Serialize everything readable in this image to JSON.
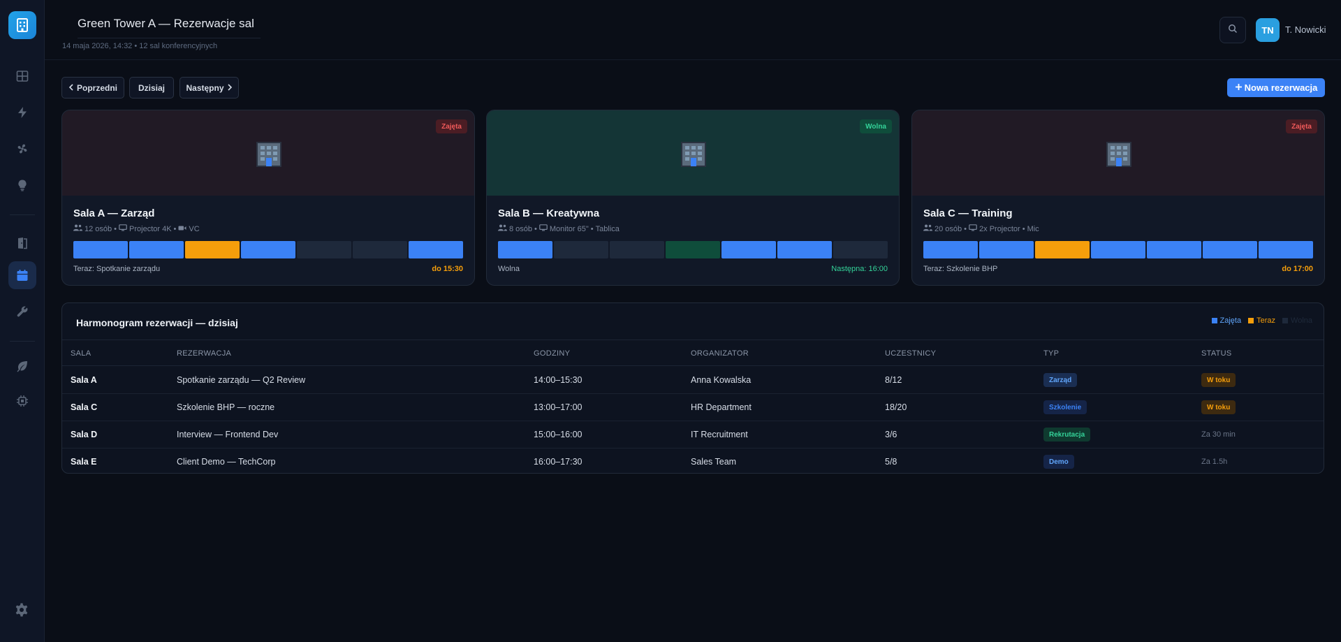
{
  "header": {
    "title": "Green Tower A — Rezerwacje sal",
    "subtitle": "14 maja 2026, 14:32 • 12 sal konferencyjnych",
    "user_initials": "TN",
    "user_name": "T. Nowicki"
  },
  "sidebar": {
    "items": [
      {
        "icon": "dashboard-grid-icon"
      },
      {
        "icon": "lightning-icon"
      },
      {
        "icon": "fan-icon"
      },
      {
        "icon": "lightbulb-icon"
      },
      {
        "icon": "door-icon"
      },
      {
        "icon": "calendar-icon",
        "active": true
      },
      {
        "icon": "wrench-icon"
      },
      {
        "icon": "leaf-icon"
      },
      {
        "icon": "chip-icon"
      },
      {
        "icon": "settings-gear-icon"
      }
    ]
  },
  "toolbar": {
    "prev_label": "Poprzedni",
    "today_label": "Dzisiaj",
    "next_label": "Następny",
    "new_label": "Nowa rezerwacja"
  },
  "colors": {
    "busy": "#3b82f6",
    "now": "#f59e0b",
    "free": "#1e293b",
    "available": "#0f4d3b",
    "accent": "#3b82f6"
  },
  "rooms": [
    {
      "name": "Sala A — Zarząd",
      "status": "Zajęta",
      "capacity": "12 osób",
      "equipment1": "Projector 4K",
      "equipment2": "VC",
      "slots": [
        "busy",
        "busy",
        "now",
        "busy",
        "free",
        "free",
        "busy"
      ],
      "now_text": "Teraz: Spotkanie zarządu",
      "until_text": "do 15:30"
    },
    {
      "name": "Sala B — Kreatywna",
      "status": "Wolna",
      "capacity": "8 osób",
      "equipment1": "Monitor 65\"",
      "equipment2": "Tablica",
      "slots": [
        "busy",
        "free",
        "free",
        "available",
        "busy",
        "busy",
        "free"
      ],
      "now_text": "Wolna",
      "until_text": "Następna: 16:00"
    },
    {
      "name": "Sala C — Training",
      "status": "Zajęta",
      "capacity": "20 osób",
      "equipment1": "2x Projector",
      "equipment2": "Mic",
      "slots": [
        "busy",
        "busy",
        "now",
        "busy",
        "busy",
        "busy",
        "busy"
      ],
      "now_text": "Teraz: Szkolenie BHP",
      "until_text": "do 17:00"
    }
  ],
  "schedule": {
    "title": "Harmonogram rezerwacji — dzisiaj",
    "legend": [
      "Zajęta",
      "Teraz",
      "Wolna"
    ],
    "columns": [
      "SALA",
      "REZERWACJA",
      "GODZINY",
      "ORGANIZATOR",
      "UCZESTNICY",
      "TYP",
      "STATUS"
    ],
    "rows": [
      {
        "room": "Sala A",
        "booking": "Spotkanie zarządu — Q2 Review",
        "hours": "14:00–15:30",
        "organizer": "Anna Kowalska",
        "participants": "8/12",
        "type": "Zarząd",
        "type_color": "#60a5fa",
        "type_bg": "#1a2e52",
        "status": "W toku",
        "status_active": true
      },
      {
        "room": "Sala C",
        "booking": "Szkolenie BHP — roczne",
        "hours": "13:00–17:00",
        "organizer": "HR Department",
        "participants": "18/20",
        "type": "Szkolenie",
        "type_color": "#3b82f6",
        "type_bg": "#152447",
        "status": "W toku",
        "status_active": true
      },
      {
        "room": "Sala D",
        "booking": "Interview — Frontend Dev",
        "hours": "15:00–16:00",
        "organizer": "IT Recruitment",
        "participants": "3/6",
        "type": "Rekrutacja",
        "type_color": "#34d399",
        "type_bg": "#0f3a2f",
        "status": "Za 30 min",
        "status_active": false
      },
      {
        "room": "Sala E",
        "booking": "Client Demo — TechCorp",
        "hours": "16:00–17:30",
        "organizer": "Sales Team",
        "participants": "5/8",
        "type": "Demo",
        "type_color": "#60a5fa",
        "type_bg": "#152447",
        "status": "Za 1.5h",
        "status_active": false
      }
    ]
  }
}
